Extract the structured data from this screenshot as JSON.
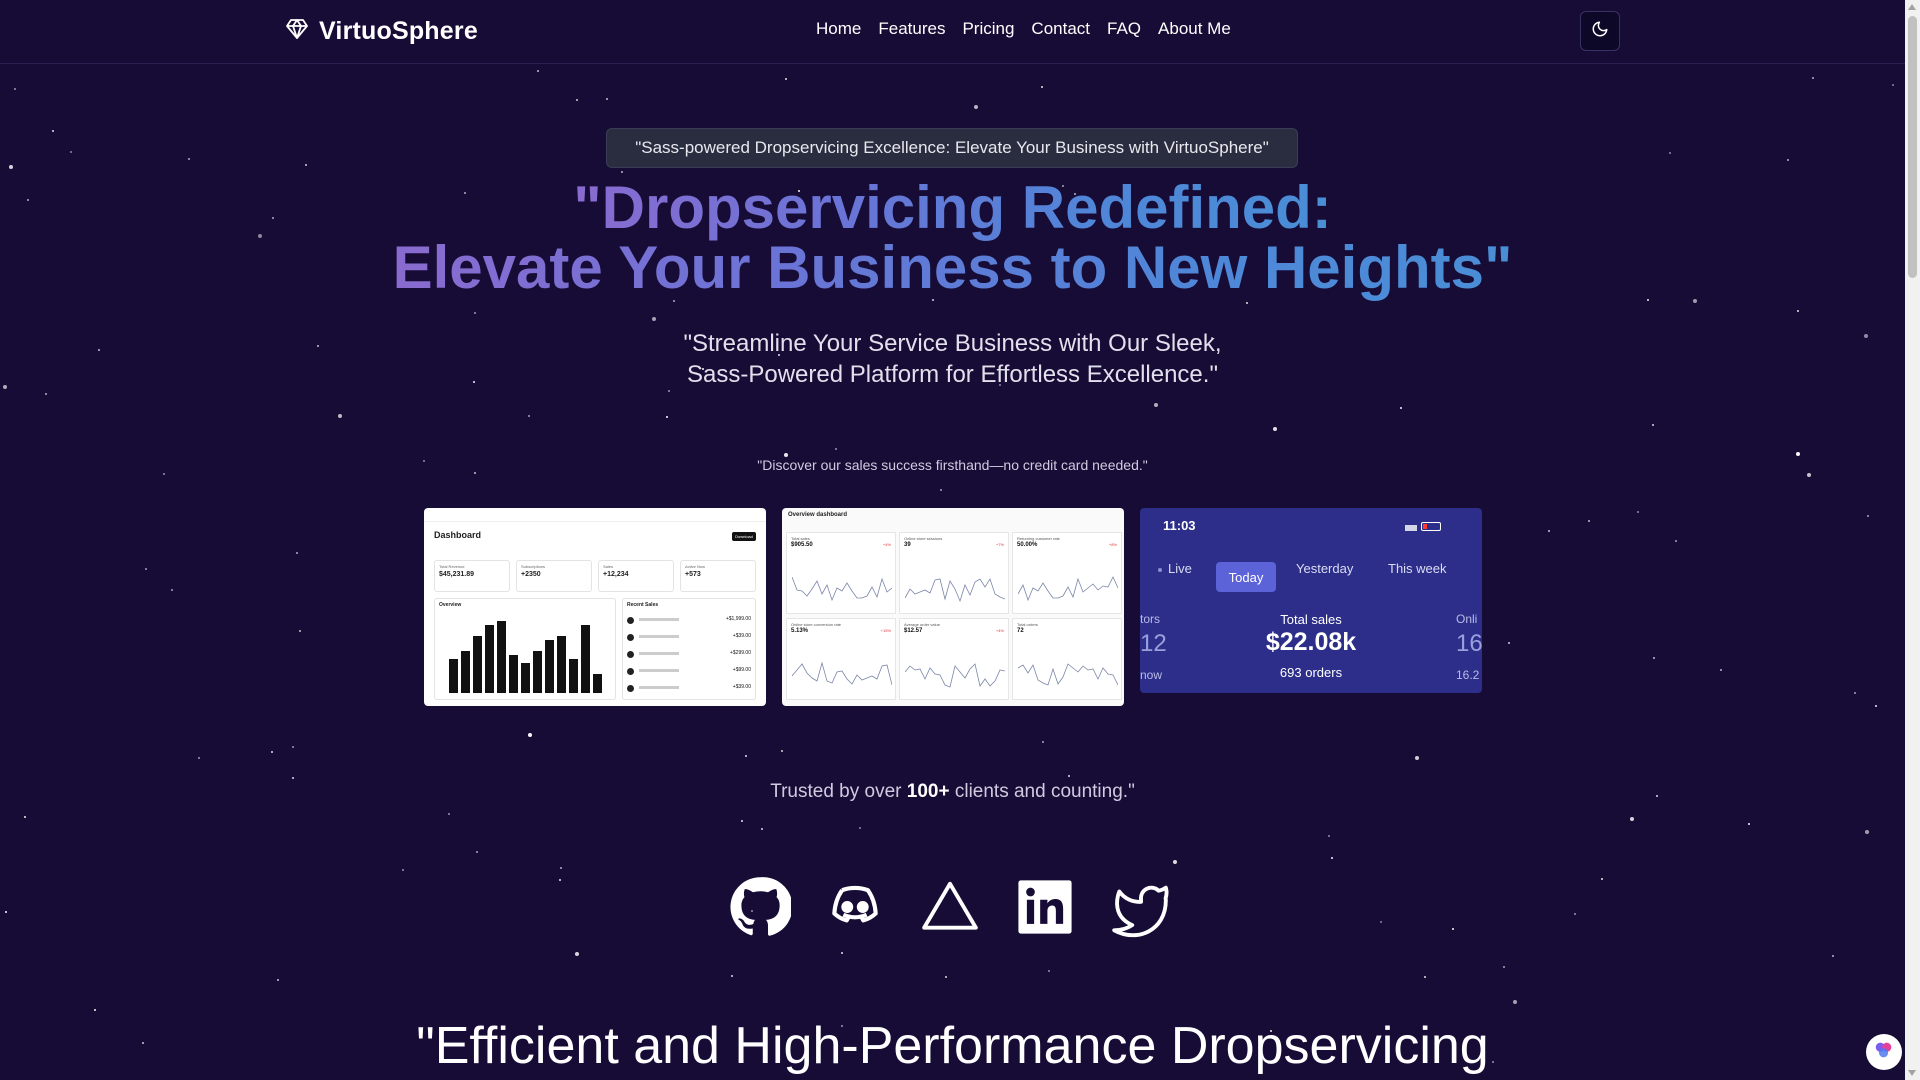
{
  "brand": {
    "name": "VirtuoSphere",
    "logo_icon": "diamond-icon"
  },
  "nav": {
    "items": [
      "Home",
      "Features",
      "Pricing",
      "Contact",
      "FAQ",
      "About Me"
    ]
  },
  "theme_toggle": {
    "icon": "moon-icon"
  },
  "hero": {
    "badge": "\"Sass-powered Dropservicing Excellence: Elevate Your Business with VirtuoSphere\"",
    "headline_line1": "\"Dropservicing Redefined:",
    "headline_line2": "Elevate Your Business to New Heights\"",
    "sub_line1": "\"Streamline Your Service Business with Our Sleek,",
    "sub_line2": "Sass-Powered Platform for Effortless Excellence.\"",
    "discover": "\"Discover our sales success firsthand—no credit card needed.\""
  },
  "screenshots": {
    "dashboard": {
      "title": "Dashboard",
      "download": "Download",
      "cards": [
        {
          "label": "Total Revenue",
          "value": "$45,231.89"
        },
        {
          "label": "Subscriptions",
          "value": "+2350"
        },
        {
          "label": "Sales",
          "value": "+12,234"
        },
        {
          "label": "Active Now",
          "value": "+573"
        }
      ],
      "overview_label": "Overview",
      "bar_values": [
        0.45,
        0.55,
        0.75,
        0.9,
        0.95,
        0.5,
        0.4,
        0.55,
        0.7,
        0.75,
        0.45,
        0.9,
        0.25
      ],
      "recent_sales_title": "Recent Sales",
      "recent_sales": [
        "+$1,999.00",
        "+$39.00",
        "+$299.00",
        "+$99.00",
        "+$39.00"
      ]
    },
    "overview": {
      "title": "Overview dashboard",
      "metrics": [
        {
          "label": "Total sales",
          "value": "$905.50",
          "delta": "+4%"
        },
        {
          "label": "Online store sessions",
          "value": "39",
          "delta": "+7%"
        },
        {
          "label": "Returning customer rate",
          "value": "50.00%",
          "delta": "+8%"
        },
        {
          "label": "Online store conversion rate",
          "value": "5.13%",
          "delta": "+15%"
        },
        {
          "label": "Average order value",
          "value": "$12.57",
          "delta": "+4%"
        },
        {
          "label": "Total orders",
          "value": "72",
          "delta": ""
        }
      ]
    },
    "mobile": {
      "time": "11:03",
      "tabs": [
        "Live",
        "Today",
        "Yesterday",
        "This week"
      ],
      "left_partial_label": "tors",
      "left_partial_value": "12",
      "left_partial_sub": "now",
      "center_label": "Total sales",
      "center_value": "$22.08k",
      "center_sub": "693 orders",
      "right_partial_label": "Onli",
      "right_partial_value": "16",
      "right_partial_sub": "16.2"
    }
  },
  "trusted": {
    "prefix": "Trusted by over ",
    "highlight": "100+",
    "suffix": " clients and counting.\""
  },
  "socials": [
    "github-icon",
    "discord-icon",
    "vercel-icon",
    "linkedin-icon",
    "twitter-icon"
  ],
  "bottom_heading": "\"Efficient and High-Performance Dropservicing"
}
